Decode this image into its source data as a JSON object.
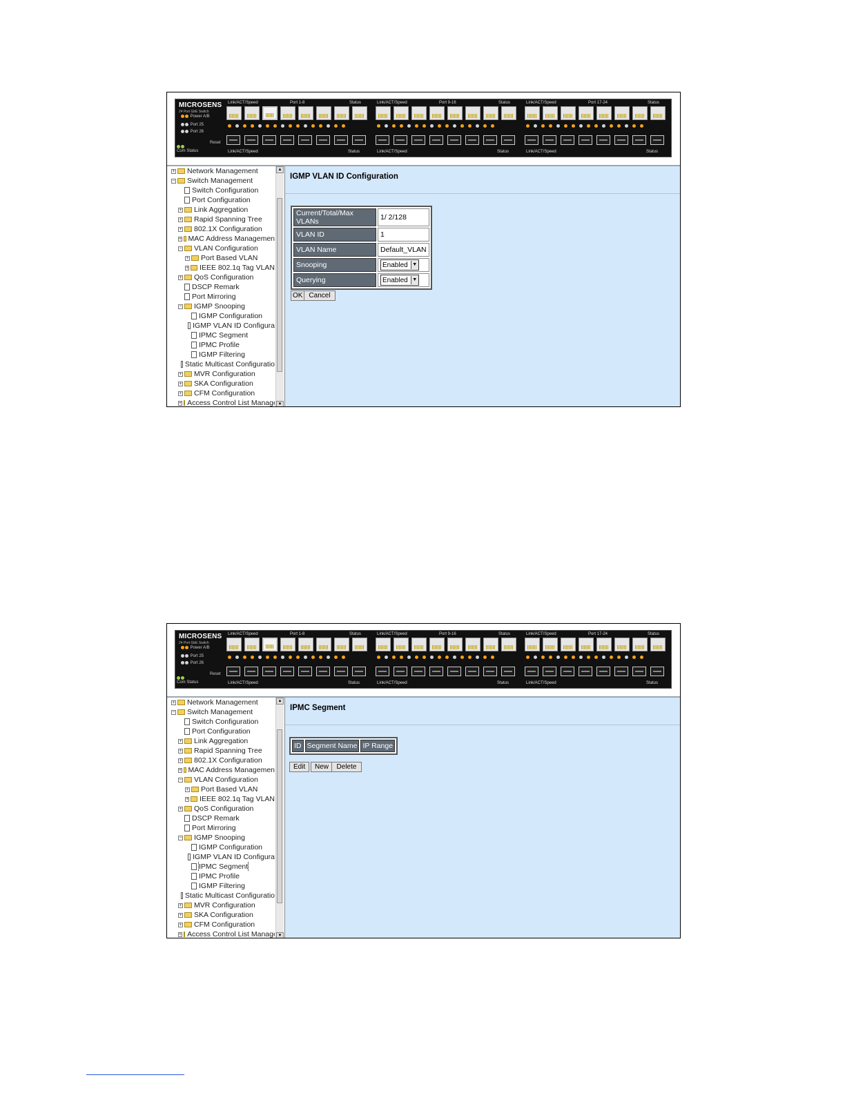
{
  "panel": {
    "brand": "MICROSENS",
    "subtitle": "24 Port GbE Switch",
    "power_label": "Power A/B",
    "port25_label": "Port 25",
    "port26_label": "Port 26",
    "com_status_label": "Com  Status",
    "reset_label": "Reset",
    "groups": [
      {
        "top_left": "Link/ACT/Speed",
        "title": "Port 1-8",
        "top_right": "Status",
        "bottom_left": "Link/ACT/Speed",
        "bottom_right": "Status"
      },
      {
        "top_left": "Link/ACT/Speed",
        "title": "Port 9-16",
        "top_right": "Status",
        "bottom_left": "Link/ACT/Speed",
        "bottom_right": "Status"
      },
      {
        "top_left": "Link/ACT/Speed",
        "title": "Port 17-24",
        "top_right": "Status",
        "bottom_left": "Link/ACT/Speed",
        "bottom_right": "Status"
      }
    ]
  },
  "tree": [
    {
      "label": "Network Management",
      "level": 0,
      "type": "folder",
      "expander": "+"
    },
    {
      "label": "Switch Management",
      "level": 0,
      "type": "folder",
      "expander": "-"
    },
    {
      "label": "Switch Configuration",
      "level": 1,
      "type": "page"
    },
    {
      "label": "Port Configuration",
      "level": 1,
      "type": "page"
    },
    {
      "label": "Link Aggregation",
      "level": 1,
      "type": "folder",
      "expander": "+"
    },
    {
      "label": "Rapid Spanning Tree",
      "level": 1,
      "type": "folder",
      "expander": "+"
    },
    {
      "label": "802.1X Configuration",
      "level": 1,
      "type": "folder",
      "expander": "+"
    },
    {
      "label": "MAC Address Managemen",
      "level": 1,
      "type": "folder",
      "expander": "+"
    },
    {
      "label": "VLAN Configuration",
      "level": 1,
      "type": "folder",
      "expander": "-"
    },
    {
      "label": "Port Based VLAN",
      "level": 2,
      "type": "folder",
      "expander": "+"
    },
    {
      "label": "IEEE 802.1q Tag VLAN",
      "level": 2,
      "type": "folder",
      "expander": "+"
    },
    {
      "label": "QoS Configuration",
      "level": 1,
      "type": "folder",
      "expander": "+"
    },
    {
      "label": "DSCP Remark",
      "level": 1,
      "type": "page"
    },
    {
      "label": "Port Mirroring",
      "level": 1,
      "type": "page"
    },
    {
      "label": "IGMP Snooping",
      "level": 1,
      "type": "folder",
      "expander": "-"
    },
    {
      "label": "IGMP Configuration",
      "level": 2,
      "type": "page"
    },
    {
      "label": "IGMP VLAN ID Configura",
      "level": 2,
      "type": "page"
    },
    {
      "label": "IPMC Segment",
      "level": 2,
      "type": "page"
    },
    {
      "label": "IPMC Profile",
      "level": 2,
      "type": "page"
    },
    {
      "label": "IGMP Filtering",
      "level": 2,
      "type": "page"
    },
    {
      "label": "Static Multicast Configuratio",
      "level": 1,
      "type": "page"
    },
    {
      "label": "MVR Configuration",
      "level": 1,
      "type": "folder",
      "expander": "+"
    },
    {
      "label": "SKA Configuration",
      "level": 1,
      "type": "folder",
      "expander": "+"
    },
    {
      "label": "CFM Configuration",
      "level": 1,
      "type": "folder",
      "expander": "+"
    },
    {
      "label": "Access Control List Manage",
      "level": 1,
      "type": "folder",
      "expander": "+"
    }
  ],
  "screen1": {
    "title": "IGMP VLAN ID Configuration",
    "rows": [
      {
        "label": "Current/Total/Max VLANs",
        "value": "1/ 2/128"
      },
      {
        "label": "VLAN ID",
        "value": "1"
      },
      {
        "label": "VLAN Name",
        "value": "Default_VLAN"
      },
      {
        "label": "Snooping",
        "select": "Enabled"
      },
      {
        "label": "Querying",
        "select": "Enabled"
      }
    ],
    "ok_label": "OK",
    "cancel_label": "Cancel"
  },
  "screen2": {
    "title": "IPMC Segment",
    "columns": [
      "ID",
      "Segment Name",
      "IP Range"
    ],
    "edit_label": "Edit",
    "new_label": "New",
    "delete_label": "Delete"
  },
  "colors": {
    "content_bg": "#d4e8fb",
    "header_cell_bg": "#5f6a75",
    "panel_bg": "#111111"
  }
}
